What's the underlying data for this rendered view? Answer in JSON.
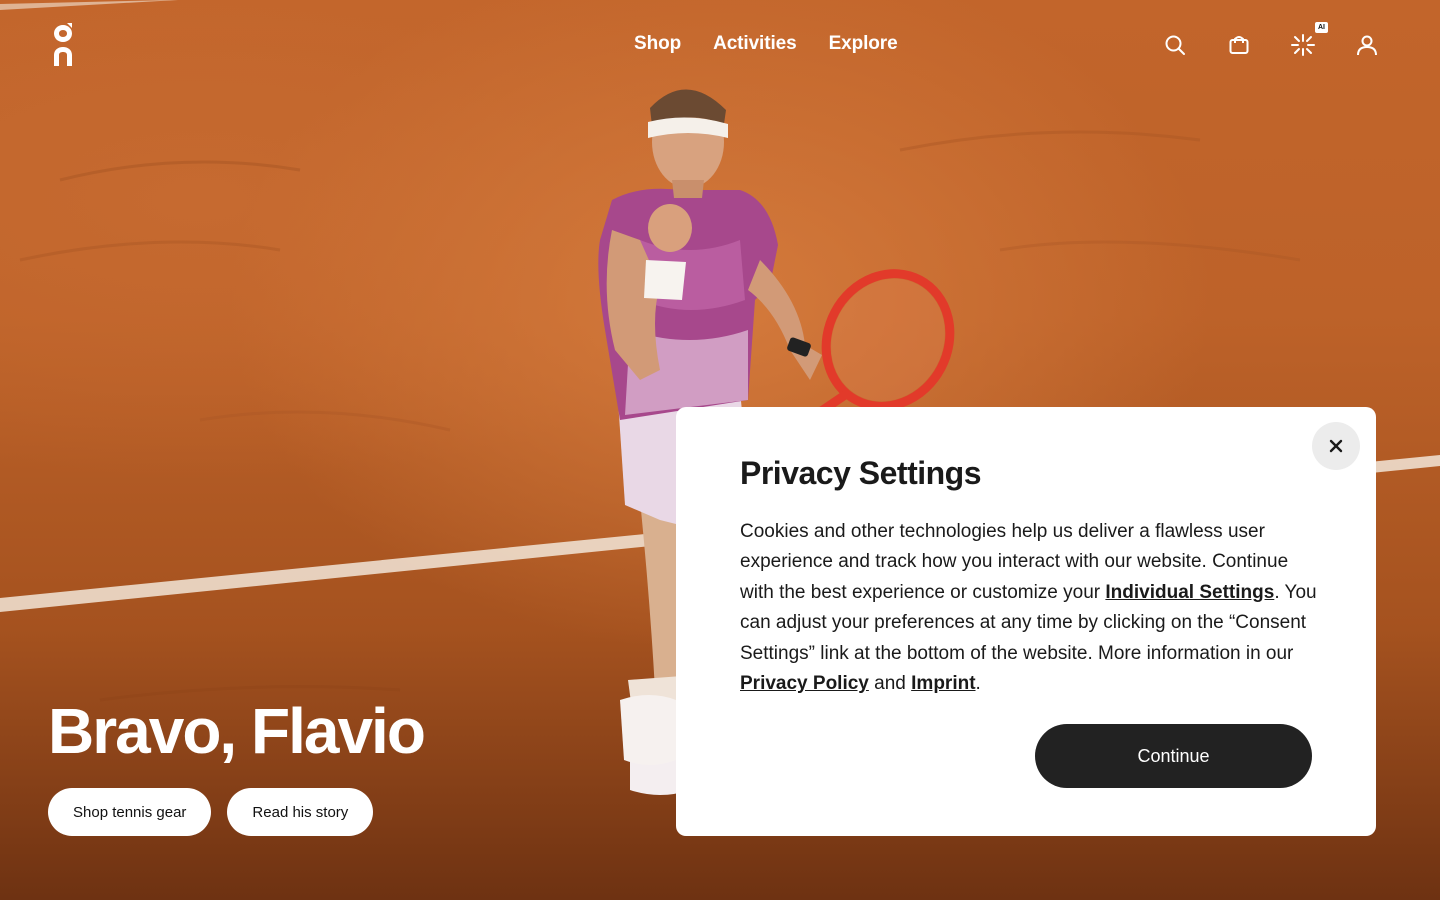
{
  "header": {
    "logo_alt": "On",
    "nav": [
      {
        "label": "Shop"
      },
      {
        "label": "Activities"
      },
      {
        "label": "Explore"
      }
    ],
    "icons": [
      "search-icon",
      "bag-icon",
      "ai-assistant-icon",
      "account-icon"
    ],
    "ai_badge": "AI"
  },
  "hero": {
    "title": "Bravo, Flavio",
    "ctas": [
      {
        "label": "Shop tennis gear"
      },
      {
        "label": "Read his story"
      }
    ]
  },
  "privacy_modal": {
    "title": "Privacy Settings",
    "body_part1": "Cookies and other technologies help us deliver a flawless user experience and track how you interact with our website. Continue with the best experience or customize your ",
    "link_individual_settings": "Individual Settings",
    "body_part2": ". You can adjust your preferences at any time by clicking on the “Consent Settings” link at the bottom of the website. More information in our ",
    "link_privacy_policy": "Privacy Policy",
    "body_part3": " and ",
    "link_imprint": "Imprint",
    "body_part4": ".",
    "continue_label": "Continue",
    "close_icon": "close-icon"
  },
  "colors": {
    "clay": "#bd6229",
    "modal_bg": "#ffffff",
    "button_dark": "#222222",
    "text": "#1a1a1a"
  }
}
